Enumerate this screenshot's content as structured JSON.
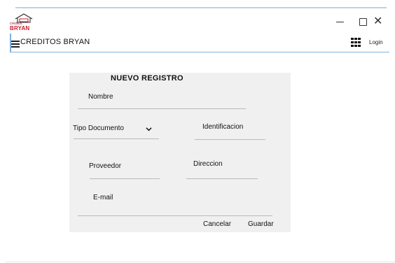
{
  "window": {
    "logo_small_text": "créditos",
    "logo_brand_text": "BRYAN",
    "minimize_icon": "minimize-icon",
    "maximize_icon": "maximize-icon",
    "close_glyph": "✕"
  },
  "appbar": {
    "title": "CREDITOS BRYAN",
    "menu_icon": "hamburger-menu-icon",
    "apps_icon": "apps-grid-icon",
    "login_label": "Login"
  },
  "form": {
    "title": "NUEVO REGISTRO",
    "nombre_label": "Nombre",
    "tipo_documento_selected": "Tipo Documento",
    "identificacion_label": "Identificacion",
    "proveedor_label": "Proveedor",
    "direccion_label": "Direccion",
    "email_label": "E-mail",
    "cancel_label": "Cancelar",
    "save_label": "Guardar"
  },
  "colors": {
    "accent_line": "#7db2e0",
    "card_background": "#f0f0f0",
    "brand_red": "#c41e2f"
  }
}
